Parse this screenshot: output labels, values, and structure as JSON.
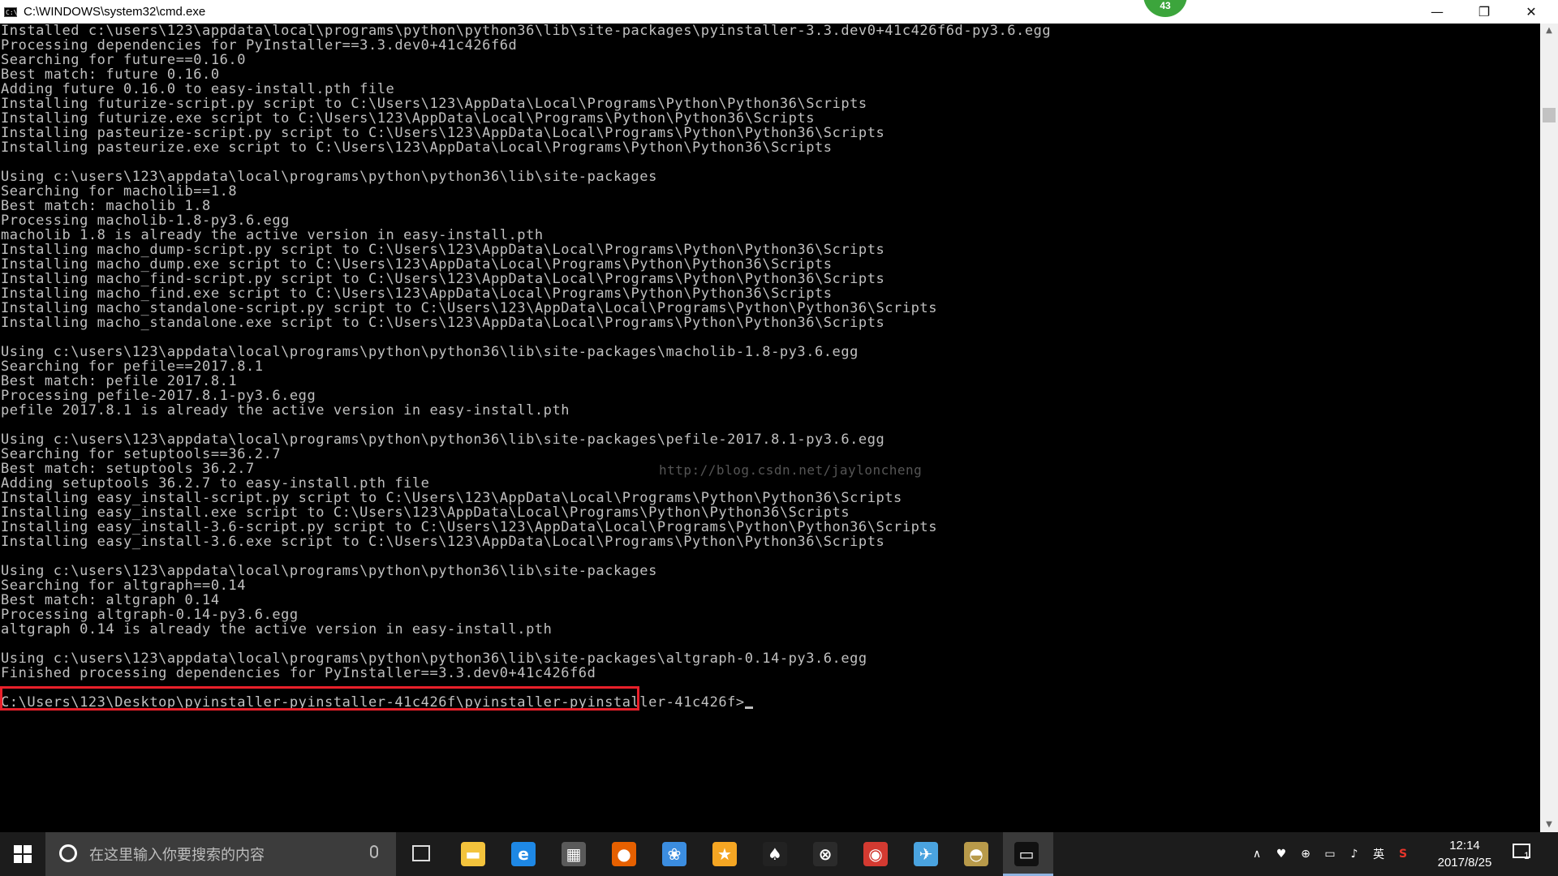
{
  "window": {
    "title": "C:\\WINDOWS\\system32\\cmd.exe",
    "badge": "43",
    "minimize_glyph": "—",
    "maximize_glyph": "❐",
    "close_glyph": "✕",
    "app_icon_text": "C:\\"
  },
  "console": {
    "lines": [
      "Installed c:\\users\\123\\appdata\\local\\programs\\python\\python36\\lib\\site-packages\\pyinstaller-3.3.dev0+41c426f6d-py3.6.egg",
      "Processing dependencies for PyInstaller==3.3.dev0+41c426f6d",
      "Searching for future==0.16.0",
      "Best match: future 0.16.0",
      "Adding future 0.16.0 to easy-install.pth file",
      "Installing futurize-script.py script to C:\\Users\\123\\AppData\\Local\\Programs\\Python\\Python36\\Scripts",
      "Installing futurize.exe script to C:\\Users\\123\\AppData\\Local\\Programs\\Python\\Python36\\Scripts",
      "Installing pasteurize-script.py script to C:\\Users\\123\\AppData\\Local\\Programs\\Python\\Python36\\Scripts",
      "Installing pasteurize.exe script to C:\\Users\\123\\AppData\\Local\\Programs\\Python\\Python36\\Scripts",
      "",
      "Using c:\\users\\123\\appdata\\local\\programs\\python\\python36\\lib\\site-packages",
      "Searching for macholib==1.8",
      "Best match: macholib 1.8",
      "Processing macholib-1.8-py3.6.egg",
      "macholib 1.8 is already the active version in easy-install.pth",
      "Installing macho_dump-script.py script to C:\\Users\\123\\AppData\\Local\\Programs\\Python\\Python36\\Scripts",
      "Installing macho_dump.exe script to C:\\Users\\123\\AppData\\Local\\Programs\\Python\\Python36\\Scripts",
      "Installing macho_find-script.py script to C:\\Users\\123\\AppData\\Local\\Programs\\Python\\Python36\\Scripts",
      "Installing macho_find.exe script to C:\\Users\\123\\AppData\\Local\\Programs\\Python\\Python36\\Scripts",
      "Installing macho_standalone-script.py script to C:\\Users\\123\\AppData\\Local\\Programs\\Python\\Python36\\Scripts",
      "Installing macho_standalone.exe script to C:\\Users\\123\\AppData\\Local\\Programs\\Python\\Python36\\Scripts",
      "",
      "Using c:\\users\\123\\appdata\\local\\programs\\python\\python36\\lib\\site-packages\\macholib-1.8-py3.6.egg",
      "Searching for pefile==2017.8.1",
      "Best match: pefile 2017.8.1",
      "Processing pefile-2017.8.1-py3.6.egg",
      "pefile 2017.8.1 is already the active version in easy-install.pth",
      "",
      "Using c:\\users\\123\\appdata\\local\\programs\\python\\python36\\lib\\site-packages\\pefile-2017.8.1-py3.6.egg",
      "Searching for setuptools==36.2.7",
      "Best match: setuptools 36.2.7",
      "Adding setuptools 36.2.7 to easy-install.pth file",
      "Installing easy_install-script.py script to C:\\Users\\123\\AppData\\Local\\Programs\\Python\\Python36\\Scripts",
      "Installing easy_install.exe script to C:\\Users\\123\\AppData\\Local\\Programs\\Python\\Python36\\Scripts",
      "Installing easy_install-3.6-script.py script to C:\\Users\\123\\AppData\\Local\\Programs\\Python\\Python36\\Scripts",
      "Installing easy_install-3.6.exe script to C:\\Users\\123\\AppData\\Local\\Programs\\Python\\Python36\\Scripts",
      "",
      "Using c:\\users\\123\\appdata\\local\\programs\\python\\python36\\lib\\site-packages",
      "Searching for altgraph==0.14",
      "Best match: altgraph 0.14",
      "Processing altgraph-0.14-py3.6.egg",
      "altgraph 0.14 is already the active version in easy-install.pth",
      "",
      "Using c:\\users\\123\\appdata\\local\\programs\\python\\python36\\lib\\site-packages\\altgraph-0.14-py3.6.egg",
      "Finished processing dependencies for PyInstaller==3.3.dev0+41c426f6d",
      ""
    ],
    "prompt": "C:\\Users\\123\\Desktop\\pyinstaller-pyinstaller-41c426f\\pyinstaller-pyinstaller-41c426f>",
    "watermark": "http://blog.csdn.net/jayloncheng",
    "highlight_color": "#e8202a",
    "text_color": "#c0c0c0"
  },
  "scrollbar": {
    "up_glyph": "▲",
    "down_glyph": "▼"
  },
  "taskbar": {
    "search_placeholder": "在这里输入你要搜索的内容",
    "apps": [
      {
        "name": "file-explorer-icon",
        "glyph": "▬",
        "color": "#f3c33c"
      },
      {
        "name": "edge-icon",
        "glyph": "e",
        "color": "#1e88e5"
      },
      {
        "name": "store-icon",
        "glyph": "▦",
        "color": "#5a5a5a"
      },
      {
        "name": "firefox-icon",
        "glyph": "●",
        "color": "#e66000"
      },
      {
        "name": "baidu-netdisk-icon",
        "glyph": "❀",
        "color": "#3b8de0"
      },
      {
        "name": "browser-icon",
        "glyph": "★",
        "color": "#f5a623"
      },
      {
        "name": "qq-icon",
        "glyph": "♠",
        "color": "#222222"
      },
      {
        "name": "xbox-icon",
        "glyph": "⊗",
        "color": "#2b2b2b"
      },
      {
        "name": "netease-music-icon",
        "glyph": "◉",
        "color": "#d33a31"
      },
      {
        "name": "feather-icon",
        "glyph": "✈",
        "color": "#4aa3df"
      },
      {
        "name": "game-icon",
        "glyph": "◓",
        "color": "#b89a4a"
      },
      {
        "name": "cmd-icon",
        "glyph": "▭",
        "color": "#111111"
      }
    ],
    "tray": [
      {
        "name": "tray-expand-icon",
        "glyph": "∧"
      },
      {
        "name": "tray-app-icon",
        "glyph": "♥"
      },
      {
        "name": "tray-plus-icon",
        "glyph": "⊕"
      },
      {
        "name": "battery-icon",
        "glyph": "▭"
      },
      {
        "name": "volume-icon",
        "glyph": "♪"
      },
      {
        "name": "ime-icon",
        "glyph": "英"
      },
      {
        "name": "sogou-icon",
        "glyph": "S"
      }
    ],
    "time": "12:14",
    "date": "2017/8/25",
    "notification_count": "1"
  }
}
